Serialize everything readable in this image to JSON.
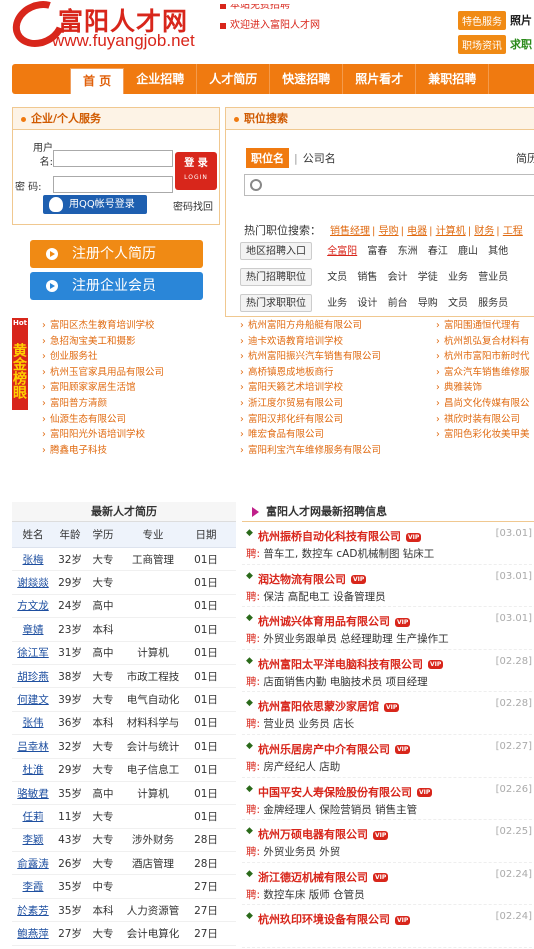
{
  "header": {
    "logo_cn": "富阳人才网",
    "logo_en": "www.fuyangjob.net",
    "notices": [
      "本站免费招聘",
      "欢迎进入富阳人才网"
    ],
    "toplinks": [
      {
        "tag": "特色服务",
        "text": "照片",
        "color": "#1a1a1a"
      },
      {
        "tag": "职场资讯",
        "text": "求职",
        "color": "#2a8a1a"
      }
    ]
  },
  "nav": [
    "首 页",
    "企业招聘",
    "人才简历",
    "快速招聘",
    "照片看才",
    "兼职招聘"
  ],
  "services": {
    "title": "企业/个人服务",
    "user_label": "用户名:",
    "pwd_label": "密 码:",
    "login": "登 录",
    "login_en": "LOGIN",
    "qq_login": "用QQ帐号登录",
    "forgot": "密码找回",
    "reg_person": "注册个人简历",
    "reg_company": "注册企业会员"
  },
  "search": {
    "title": "职位搜索",
    "tab_job": "职位名",
    "tab_company": "公司名",
    "tab_right": "简历",
    "hot_label": "热门职位搜索：",
    "hot_words": [
      "销售经理",
      "导购",
      "电器",
      "计算机",
      "财务",
      "工程"
    ],
    "rows": [
      {
        "btn": "地区招聘入口",
        "items": [
          "全富阳",
          "富春",
          "东洲",
          "春江",
          "鹿山",
          "其他"
        ]
      },
      {
        "btn": "热门招聘职位",
        "items": [
          "文员",
          "销售",
          "会计",
          "学徒",
          "业务",
          "营业员"
        ]
      },
      {
        "btn": "热门求职职位",
        "items": [
          "业务",
          "设计",
          "前台",
          "导购",
          "文员",
          "服务员"
        ]
      }
    ]
  },
  "famous": {
    "tag": "黄金榜眼",
    "col1": [
      "富阳区杰生教育培训学校",
      "急招淘宝美工和摄影",
      "创业服务社",
      "杭州玉官家具用品有限公司",
      "富阳顾家家居生活馆",
      "富阳普方清颜",
      "仙源生态有限公司",
      "富阳阳光外语培训学校",
      "腾鑫电子科技"
    ],
    "col2": [
      "杭州富阳方舟船艇有限公司",
      "迪卡欢语教育培训学校",
      "杭州富阳振兴汽车销售有限公司",
      "高桥镇恩成地板商行",
      "富阳天籁艺术培训学校",
      "浙江度尔贸易有限公司",
      "富阳汉邦化纤有限公司",
      "唯宏食品有限公司",
      "富阳利宝汽车维修服务有限公司"
    ],
    "col3": [
      "富阳围通恒代理有",
      "杭州凯弘复合材料有",
      "杭州市富阳市新时代",
      "富众汽车销售维修服",
      "典雅装饰",
      "昌尚文化传媒有限公",
      "祺欣时装有限公司",
      "富阳色彩化妆美甲美"
    ]
  },
  "resumes": {
    "title": "最新人才简历",
    "headers": [
      "姓名",
      "年龄",
      "学历",
      "专业",
      "日期"
    ],
    "rows": [
      [
        "张梅",
        "32岁",
        "大专",
        "工商管理",
        "01日"
      ],
      [
        "谢燚燚",
        "29岁",
        "大专",
        "",
        "01日"
      ],
      [
        "方文龙",
        "24岁",
        "高中",
        "",
        "01日"
      ],
      [
        "章婧",
        "23岁",
        "本科",
        "",
        "01日"
      ],
      [
        "徐江军",
        "31岁",
        "高中",
        "计算机",
        "01日"
      ],
      [
        "胡珍燕",
        "38岁",
        "大专",
        "市政工程技",
        "01日"
      ],
      [
        "何建文",
        "39岁",
        "大专",
        "电气自动化",
        "01日"
      ],
      [
        "张伟",
        "36岁",
        "本科",
        "材料科学与",
        "01日"
      ],
      [
        "吕幸林",
        "32岁",
        "大专",
        "会计与统计",
        "01日"
      ],
      [
        "杜淮",
        "29岁",
        "大专",
        "电子信息工",
        "01日"
      ],
      [
        "骆敏君",
        "35岁",
        "高中",
        "计算机",
        "01日"
      ],
      [
        "任莉",
        "11岁",
        "大专",
        "",
        "01日"
      ],
      [
        "李颖",
        "43岁",
        "大专",
        "涉外财务",
        "28日"
      ],
      [
        "俞露涛",
        "26岁",
        "大专",
        "酒店管理",
        "28日"
      ],
      [
        "李霞",
        "35岁",
        "中专",
        "",
        "27日"
      ],
      [
        "於素芳",
        "35岁",
        "本科",
        "人力资源管",
        "27日"
      ],
      [
        "鲍燕萍",
        "27岁",
        "大专",
        "会计电算化",
        "27日"
      ]
    ]
  },
  "jobs": {
    "title": "富阳人才网最新招聘信息",
    "vip": "VIP",
    "hire": "聘:",
    "items": [
      {
        "company": "杭州振桥自动化科技有限公司",
        "date": "[03.01]",
        "positions": "普车工, 数控车 cAD机械制图 钻床工"
      },
      {
        "company": "润达物流有限公司",
        "date": "[03.01]",
        "positions": "保洁 高配电工 设备管理员"
      },
      {
        "company": "杭州诚兴体育用品有限公司",
        "date": "[03.01]",
        "positions": "外贸业务跟单员 总经理助理 生产操作工"
      },
      {
        "company": "杭州富阳太平洋电脑科技有限公司",
        "date": "[02.28]",
        "positions": "店面销售内勤 电脑技术员 项目经理"
      },
      {
        "company": "杭州富阳依思蒙沙家居馆",
        "date": "[02.28]",
        "positions": "营业员 业务员 店长"
      },
      {
        "company": "杭州乐居房产中介有限公司",
        "date": "[02.27]",
        "positions": "房产经纪人 店助"
      },
      {
        "company": "中国平安人寿保险股份有限公司",
        "date": "[02.26]",
        "positions": "金牌经理人 保险营销员 销售主管"
      },
      {
        "company": "杭州万硕电器有限公司",
        "date": "[02.25]",
        "positions": "外贸业务员 外贸"
      },
      {
        "company": "浙江德迈机械有限公司",
        "date": "[02.24]",
        "positions": "数控车床 版师 仓管员"
      },
      {
        "company": "杭州玖印环境设备有限公司",
        "date": "[02.24]",
        "positions": ""
      }
    ]
  }
}
